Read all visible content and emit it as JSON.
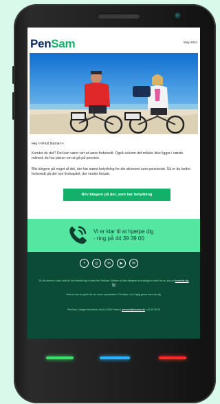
{
  "email": {
    "logo_part1": "Pen",
    "logo_part2": "Sam",
    "date": "May 2024",
    "greeting": "Hej <<First Name>>",
    "paragraph1": "Kender du det? Det kan være rart at være forberedt. Også selvom det måske ikke ligger i næste måned, du har planer om at gå på pension.",
    "paragraph2": "Bliv klogere på noget af det, der har størst betydning for din økonomi som pensionist. Så er du bedre forberedt på det nye livskapitel, der venter forude.",
    "cta_label": "Bliv klogere på det, som har betydning",
    "help_line1": "Vi er klar til at hjælpe dig",
    "help_line2": "- ring på 44 39 39 00",
    "footer_line1": "Du får denne e-mail, fordi du har tilmeldt dig e-mails fra PenSam. Ønsker du ikke længere at modtage e-mails fra os, kan du",
    "footer_link": "framelde dig her",
    "footer_line2": "Hvis du har du gode idé om vores nyhedsbrev i PenSam, vil vi rigtig gerne høre fra dig.",
    "footer_contact": "PenSam | Jørgen Knudsens Vej 6 | 3520 Farum |",
    "footer_email": "pensam@pensam.dk",
    "footer_phone": "| 44 39 39 00",
    "social_icons": [
      "facebook-icon",
      "instagram-icon",
      "linkedin-icon",
      "youtube-icon",
      "email-icon"
    ]
  },
  "colors": {
    "brand_navy": "#0a2a66",
    "brand_green": "#14b36b",
    "band_green": "#55e7a2",
    "footer_dark": "#0a4c38",
    "page_bg": "#d9f9ea"
  }
}
